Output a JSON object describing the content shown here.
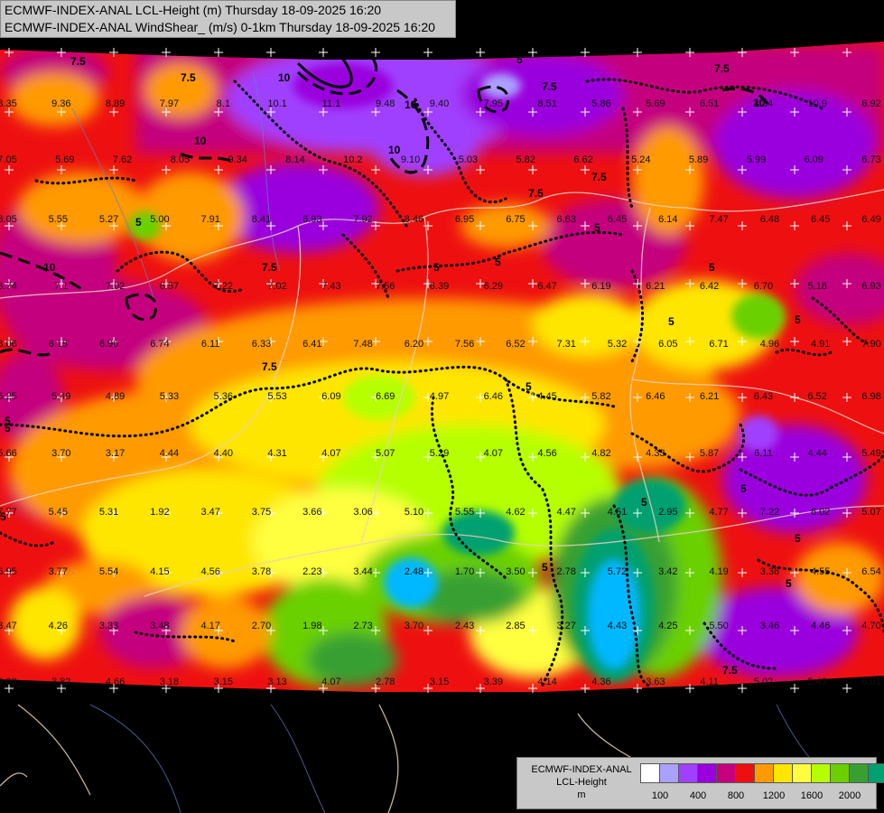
{
  "header": {
    "line1": "ECMWF-INDEX-ANAL LCL-Height (m) Thursday 18-09-2025 16:20",
    "line2": "ECMWF-INDEX-ANAL WindShear_ (m/s) 0-1km Thursday 18-09-2025 16:20"
  },
  "legend": {
    "line1": "ECMWF-INDEX-ANAL",
    "line2": "LCL-Height",
    "line3": "m",
    "colors": [
      "#ffffff",
      "#aaa0ff",
      "#a040ff",
      "#9a00dd",
      "#c4007e",
      "#ee1010",
      "#ff9a00",
      "#ffe600",
      "#ffff40",
      "#b6ff00",
      "#6bd000",
      "#38a030",
      "#00a070",
      "#00b8ff"
    ],
    "ticks": [
      "100",
      "400",
      "800",
      "1200",
      "1600",
      "2000"
    ]
  },
  "contour_labels": [
    "7.5",
    "10",
    "7.5",
    "10",
    "7.5",
    "5",
    "10",
    "5",
    "7.5",
    "10",
    "7.5",
    "5",
    "10",
    "7.5",
    "5",
    "5",
    "5",
    "7.5",
    "5",
    "5",
    "5",
    "5",
    "5",
    "7.5",
    "5",
    "5",
    "5",
    "5",
    "5",
    "7.5",
    "5",
    "10"
  ],
  "grid_values": [
    "8.35",
    "9.36",
    "8.89",
    "7.97",
    "8.1",
    "10.1",
    "11.1",
    "9.48",
    "9.40",
    "7.95",
    "8.51",
    "5.86",
    "5.69",
    "6.51",
    "4.84",
    "10.9",
    "6.92",
    "7.05",
    "5.69",
    "7.62",
    "8.05",
    "9.34",
    "8.14",
    "10.2",
    "9.10",
    "5.03",
    "5.82",
    "6.62",
    "5.24",
    "5.89",
    "5.99",
    "6.09",
    "6.73",
    "8.05",
    "5.55",
    "5.27",
    "5.00",
    "7.91",
    "8.41",
    "6.93",
    "7.92",
    "8.46",
    "6.95",
    "6.75",
    "6.63",
    "6.45",
    "6.14",
    "7.47",
    "6.48",
    "6.45",
    "6.49",
    "6.74",
    "7.1",
    "7.02",
    "6.57",
    "7.22",
    "7.02",
    "7.43",
    "7.56",
    "6.39",
    "6.29",
    "6.47",
    "6.19",
    "6.21",
    "6.42",
    "6.70",
    "5.18",
    "6.93",
    "8.06",
    "6.15",
    "6.90",
    "6.74",
    "6.11",
    "6.33",
    "6.41",
    "7.48",
    "6.20",
    "7.56",
    "6.52",
    "7.31",
    "5.32",
    "6.05",
    "6.71",
    "4.96",
    "4.91",
    "7.90",
    "6.25",
    "5.49",
    "4.89",
    "5.33",
    "5.36",
    "5.53",
    "6.09",
    "6.69",
    "4.97",
    "6.46",
    "4.45",
    "5.82",
    "6.46",
    "6.21",
    "6.43",
    "6.52",
    "6.98",
    "5.66",
    "3.70",
    "3.17",
    "4.44",
    "4.40",
    "4.31",
    "4.07",
    "5.07",
    "5.29",
    "4.07",
    "4.56",
    "4.82",
    "4.33",
    "5.87",
    "6.11",
    "4.44",
    "5.49",
    "7.77",
    "5.45",
    "5.31",
    "1.92",
    "3.47",
    "3.75",
    "3.66",
    "3.06",
    "5.10",
    "5.55",
    "4.62",
    "4.47",
    "4.51",
    "2.95",
    "4.77",
    "7.22",
    "6.02",
    "5.07",
    "6.95",
    "3.77",
    "5.54",
    "4.15",
    "4.56",
    "3.78",
    "2.23",
    "3.44",
    "2.48",
    "1.70",
    "3.50",
    "2.78",
    "5.72",
    "3.42",
    "4.19",
    "3.38",
    "4.55",
    "6.54",
    "3.47",
    "4.26",
    "3.33",
    "3.48",
    "4.17",
    "2.70",
    "1.98",
    "2.73",
    "3.70",
    "2.43",
    "2.85",
    "3.27",
    "4.43",
    "4.25",
    "5.50",
    "3.46",
    "4.46",
    "4.70",
    "5.00",
    "3.82",
    "4.66",
    "3.18",
    "3.15",
    "3.13",
    "4.07",
    "2.78",
    "3.15",
    "3.39",
    "4.14",
    "4.36",
    "3.63",
    "4.11",
    "5.02",
    "5.43",
    "6.01",
    "4.18"
  ]
}
